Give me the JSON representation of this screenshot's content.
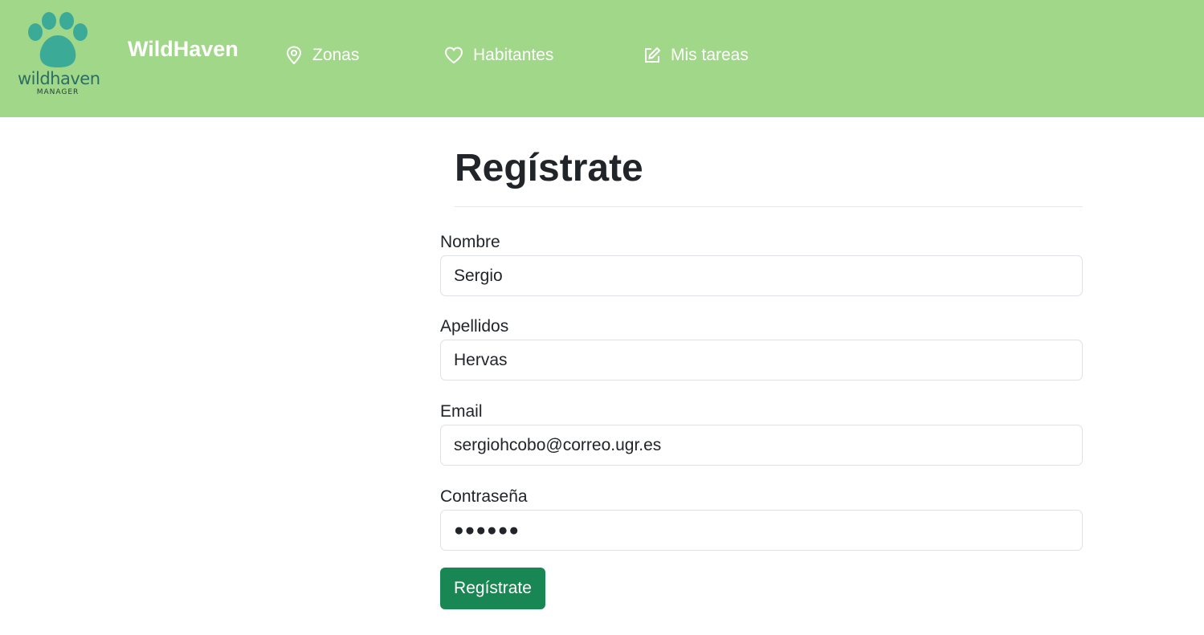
{
  "header": {
    "logo": {
      "word": "wildhaven",
      "sub": "MANAGER",
      "icon": "paw-icon",
      "color": "#3bab98"
    },
    "brand": "WildHaven",
    "background": "#a1d788",
    "nav": [
      {
        "label": "Zonas",
        "icon": "map-pin-icon"
      },
      {
        "label": "Habitantes",
        "icon": "heart-icon"
      },
      {
        "label": "Mis tareas",
        "icon": "edit-icon"
      }
    ]
  },
  "form": {
    "title": "Regístrate",
    "fields": [
      {
        "label": "Nombre",
        "value": "Sergio"
      },
      {
        "label": "Apellidos",
        "value": "Hervas"
      },
      {
        "label": "Email",
        "value": "sergiohcobo@correo.ugr.es"
      },
      {
        "label": "Contraseña",
        "value": "●●●●●●"
      }
    ],
    "submit_label": "Regístrate",
    "submit_color": "#198754"
  }
}
